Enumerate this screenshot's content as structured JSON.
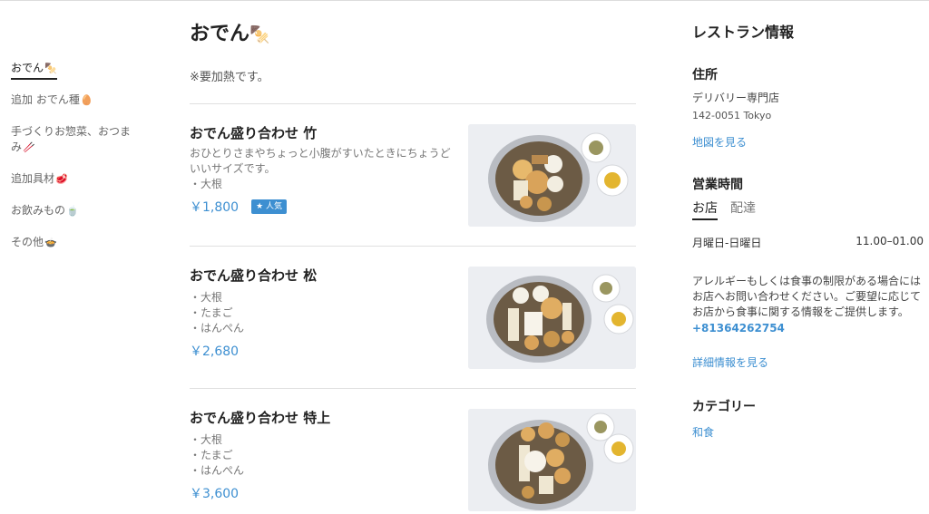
{
  "nav": {
    "items": [
      {
        "label": "おでん",
        "emoji": "🍢",
        "active": true
      },
      {
        "label": "追加 おでん種",
        "emoji": "🥚"
      },
      {
        "label": "手づくりお惣菜、おつまみ",
        "emoji": "🥢"
      },
      {
        "label": "追加具材",
        "emoji": "🥩"
      },
      {
        "label": "お飲みもの",
        "emoji": "🍵"
      },
      {
        "label": "その他",
        "emoji": "🍲"
      }
    ]
  },
  "section": {
    "title": "おでん",
    "title_emoji": "🍢",
    "note": "※要加熱です。"
  },
  "items": [
    {
      "name": "おでん盛り合わせ 竹",
      "description": "おひとりさまやちょっと小腹がすいたときにちょうどいいサイズです。",
      "contents": [
        "・大根"
      ],
      "price": "￥1,800",
      "badge": "★ 人気"
    },
    {
      "name": "おでん盛り合わせ 松",
      "contents": [
        "・大根",
        "・たまご",
        "・はんぺん"
      ],
      "price": "￥2,680"
    },
    {
      "name": "おでん盛り合わせ 特上",
      "contents": [
        "・大根",
        "・たまご",
        "・はんぺん"
      ],
      "price": "￥3,600"
    }
  ],
  "info": {
    "title": "レストラン情報",
    "address_heading": "住所",
    "address_name": "デリバリー専門店",
    "address_postal": "142-0051 Tokyo",
    "map_link": "地図を見る",
    "hours_heading": "営業時間",
    "tabs": [
      "お店",
      "配達"
    ],
    "hours_days": "月曜日-日曜日",
    "hours_time": "11.00–01.00",
    "allergy_text": "アレルギーもしくは食事の制限がある場合にはお店へお問い合わせください。ご要望に応じてお店から食事に関する情報をご提供します。",
    "phone": "+81364262754",
    "details_link": "詳細情報を見る",
    "category_heading": "カテゴリー",
    "category": "和食"
  },
  "colors": {
    "accent": "#3d8fd1",
    "text": "#222222",
    "muted": "#777777"
  }
}
